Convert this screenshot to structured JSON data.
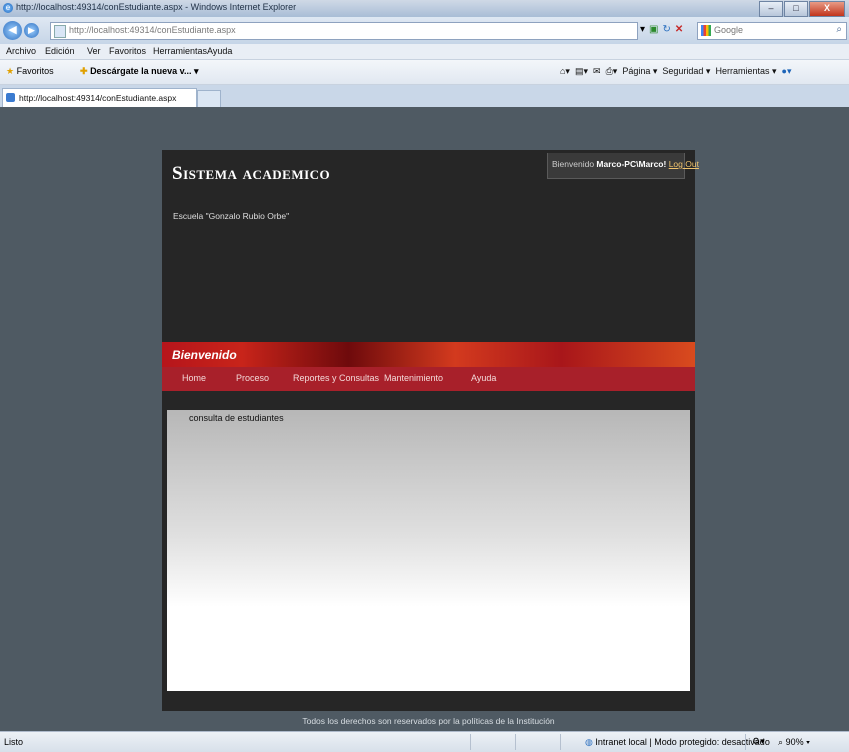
{
  "window": {
    "title": "http://localhost:49314/conEstudiante.aspx - Windows Internet Explorer",
    "minimize": "–",
    "maximize": "□",
    "close": "X"
  },
  "address_bar": {
    "url": "http://localhost:49314/conEstudiante.aspx",
    "search_placeholder": "Google"
  },
  "menu_bar": [
    "Archivo",
    "Edición",
    "Ver",
    "Favoritos",
    "Herramientas",
    "Ayuda"
  ],
  "favorites_bar": {
    "favorites_label": "Favoritos",
    "suggested": "Descárgate la nueva v... ▾"
  },
  "command_bar": {
    "page": "Página ▾",
    "security": "Seguridad ▾",
    "tools": "Herramientas ▾"
  },
  "tab": {
    "label": "http://localhost:49314/conEstudiante.aspx"
  },
  "site": {
    "title": "Sistema academico",
    "school": "Escuela \"Gonzalo Rubio Orbe\"",
    "login": {
      "prefix": "Bienvenido ",
      "user": "Marco-PC\\Marco!",
      "logout": "Log Out"
    },
    "welcome": "Bienvenido",
    "nav": [
      "Home",
      "Proceso",
      "Reportes y Consultas",
      "Mantenimiento",
      "Ayuda"
    ],
    "content_label": "consulta de estudiantes",
    "footer": "Todos los derechos son reservados por la políticas de la Institución"
  },
  "status_bar": {
    "left": "Listo",
    "zone": "Intranet local | Modo protegido: desactivado",
    "zoom": "90%"
  }
}
